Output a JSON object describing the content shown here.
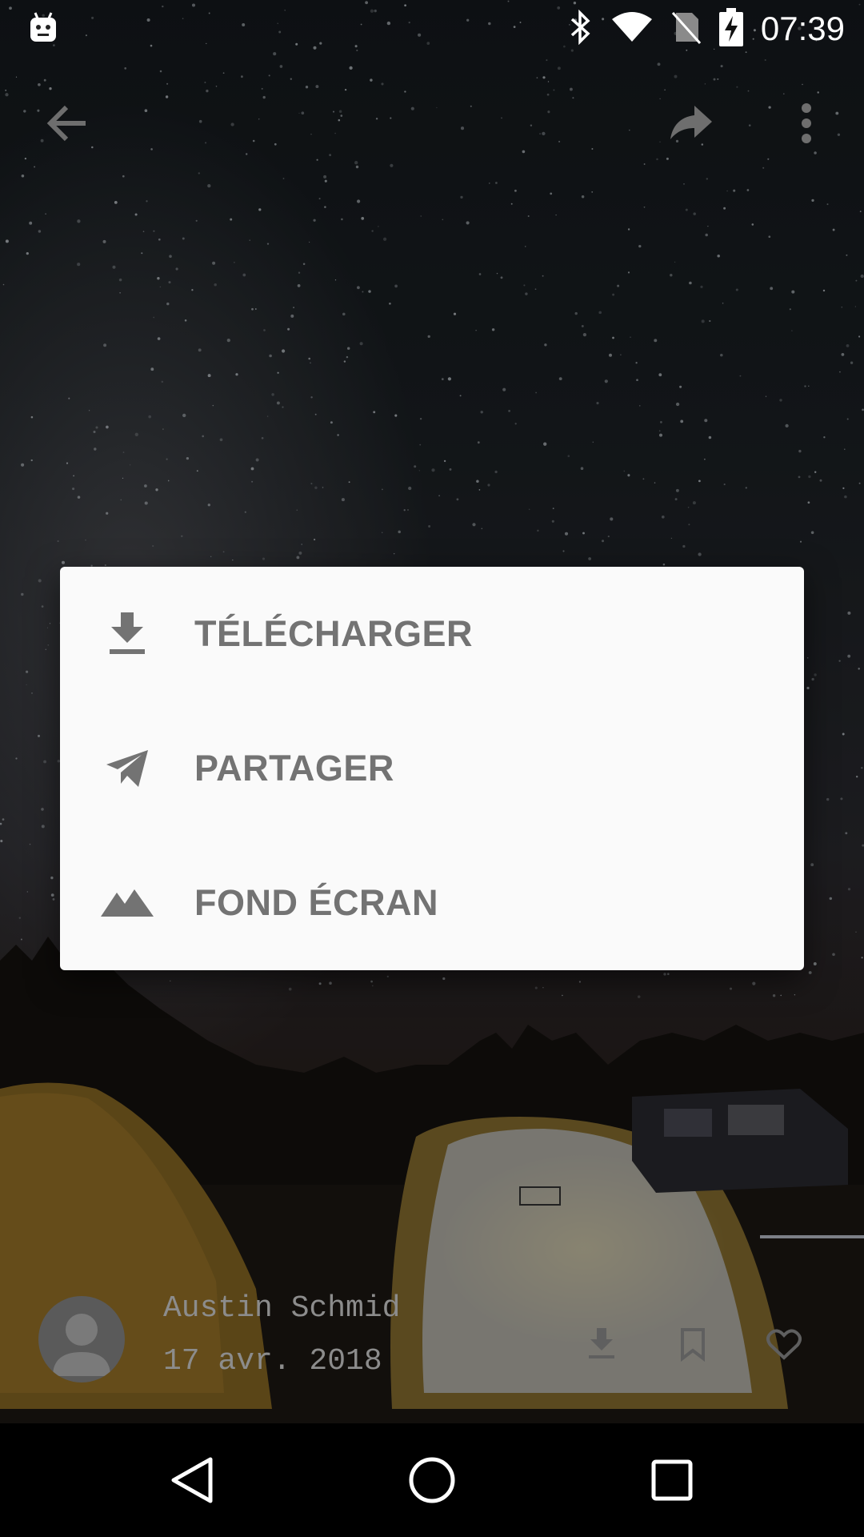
{
  "status_bar": {
    "time": "07:39",
    "icons": [
      "android-notification-icon",
      "bluetooth-icon",
      "wifi-icon",
      "no-sim-icon",
      "battery-charging-icon"
    ]
  },
  "toolbar": {
    "back_icon": "arrow-back-icon",
    "share_icon": "share-forward-icon",
    "more_icon": "more-vert-icon"
  },
  "dialog": {
    "items": [
      {
        "label": "TÉLÉCHARGER",
        "icon": "download-icon"
      },
      {
        "label": "PARTAGER",
        "icon": "send-icon"
      },
      {
        "label": "FOND ÉCRAN",
        "icon": "landscape-icon"
      }
    ]
  },
  "photo_info": {
    "author": "Austin Schmid",
    "date": "17 avr. 2018",
    "actions": [
      "download-icon",
      "bookmark-icon",
      "heart-icon"
    ]
  },
  "nav_bar": {
    "buttons": [
      "back-triangle-icon",
      "home-circle-icon",
      "recents-square-icon"
    ]
  },
  "colors": {
    "dialog_bg": "#fafafa",
    "menu_text": "#737373",
    "author_text": "#8c8c8c"
  }
}
